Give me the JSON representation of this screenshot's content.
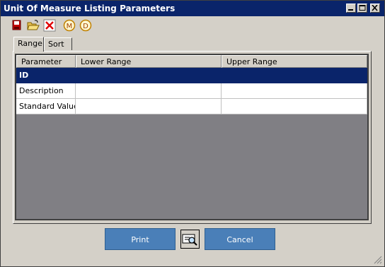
{
  "window": {
    "title": "Unit Of Measure Listing Parameters"
  },
  "titlebar_buttons": {
    "minimize": "minimize-icon",
    "maximize": "maximize-icon",
    "close": "close-icon"
  },
  "toolbar": {
    "icons": [
      "save-icon",
      "open-folder-icon",
      "delete-icon",
      "m-icon",
      "d-icon"
    ],
    "m_letter": "M",
    "d_letter": "D"
  },
  "tabs": [
    {
      "label": "Range",
      "active": true
    },
    {
      "label": "Sort",
      "active": false
    }
  ],
  "grid": {
    "columns": [
      "Parameter",
      "Lower Range",
      "Upper Range"
    ],
    "rows": [
      {
        "parameter": "ID",
        "lower": "",
        "upper": "",
        "selected": true
      },
      {
        "parameter": "Description",
        "lower": "",
        "upper": "",
        "selected": false
      },
      {
        "parameter": "Standard Value",
        "lower": "",
        "upper": "",
        "selected": false
      }
    ]
  },
  "buttons": {
    "print": "Print",
    "cancel": "Cancel",
    "preview_icon": "print-preview-icon"
  },
  "colors": {
    "title_bar": "#0a246a",
    "selected_row": "#0a246a",
    "button": "#4a7fb8",
    "grid_background": "#807f84"
  }
}
